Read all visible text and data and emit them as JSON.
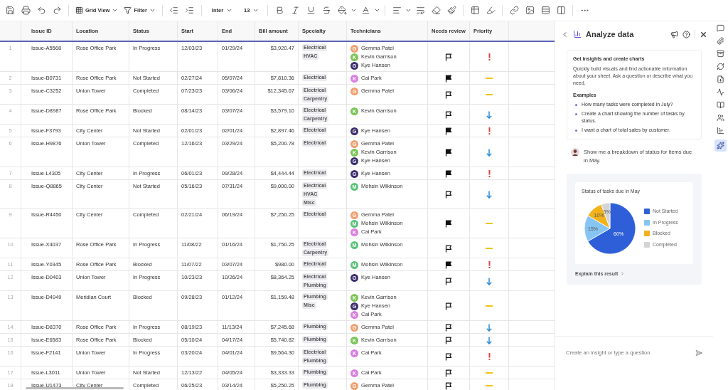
{
  "toolbar": {
    "view": "Grid View",
    "filter": "Filter",
    "font": "Inter",
    "size": "13"
  },
  "table": {
    "columns": [
      "Issue ID",
      "Location",
      "Status",
      "Start",
      "End",
      "Bill amount",
      "Specialty",
      "Technicians",
      "Needs review",
      "Priority"
    ],
    "rows": [
      {
        "num": "1",
        "id": "Issue-A5568",
        "location": "Rose Office Park",
        "status": "In Progress",
        "start": "12/03/23",
        "end": "01/29/24",
        "bill": "$3,920.47",
        "specialty": [
          "Electrical",
          "HVAC"
        ],
        "technicians": [
          {
            "initial": "G",
            "name": "Gemma Patel",
            "color": "#f0a070"
          },
          {
            "initial": "K",
            "name": "Kevin Garrison",
            "color": "#7cc456"
          },
          {
            "initial": "G",
            "name": "Kye Hansen",
            "color": "#3d2f6e"
          }
        ],
        "flagged": false,
        "priority": {
          "kind": "high"
        }
      },
      {
        "num": "2",
        "id": "Issue-B0731",
        "location": "Rose Office Park",
        "status": "Not Started",
        "start": "02/27/24",
        "end": "05/07/24",
        "bill": "$7,810.36",
        "specialty": [
          "Electrical"
        ],
        "technicians": [
          {
            "initial": "K",
            "name": "Cai Park",
            "color": "#d97ee0"
          }
        ],
        "flagged": true,
        "priority": {
          "kind": "medium"
        }
      },
      {
        "num": "3",
        "id": "Issue-C3252",
        "location": "Union Tower",
        "status": "Completed",
        "start": "07/23/23",
        "end": "03/06/24",
        "bill": "$12,345.67",
        "specialty": [
          "Electrical",
          "Carpentry"
        ],
        "technicians": [
          {
            "initial": "G",
            "name": "Gemma Patel",
            "color": "#f0a070"
          }
        ],
        "flagged": false,
        "priority": {
          "kind": "medium"
        }
      },
      {
        "num": "4",
        "id": "Issue-D8987",
        "location": "Rose Office Park",
        "status": "Blocked",
        "start": "08/14/23",
        "end": "03/07/24",
        "bill": "$3,579.10",
        "specialty": [
          "Electrical",
          "Carpentry"
        ],
        "technicians": [
          {
            "initial": "K",
            "name": "Kevin Garrison",
            "color": "#7cc456"
          }
        ],
        "flagged": false,
        "priority": {
          "kind": "low"
        }
      },
      {
        "num": "5",
        "id": "Issue-F3793",
        "location": "City Center",
        "status": "Not Started",
        "start": "02/01/23",
        "end": "02/01/24",
        "bill": "$2,897.46",
        "specialty": [
          "Electrical"
        ],
        "technicians": [
          {
            "initial": "G",
            "name": "Kye Hansen",
            "color": "#3d2f6e"
          }
        ],
        "flagged": true,
        "priority": {
          "kind": "high"
        }
      },
      {
        "num": "6",
        "id": "Issue-H9876",
        "location": "Union Tower",
        "status": "Completed",
        "start": "12/16/23",
        "end": "03/29/24",
        "bill": "$5,200.78",
        "specialty": [
          "Electrical"
        ],
        "technicians": [
          {
            "initial": "G",
            "name": "Gemma Patel",
            "color": "#f0a070"
          },
          {
            "initial": "K",
            "name": "Kevin Garrison",
            "color": "#7cc456"
          },
          {
            "initial": "G",
            "name": "Kye Hansen",
            "color": "#3d2f6e"
          }
        ],
        "flagged": true,
        "priority": {
          "kind": "low"
        }
      },
      {
        "num": "7",
        "id": "Issue-L4305",
        "location": "City Center",
        "status": "In Progress",
        "start": "06/01/23",
        "end": "09/28/24",
        "bill": "$4,444.44",
        "specialty": [
          "Electrical"
        ],
        "technicians": [
          {
            "initial": "G",
            "name": "Kye Hansen",
            "color": "#3d2f6e"
          }
        ],
        "flagged": true,
        "priority": {
          "kind": "high"
        }
      },
      {
        "num": "8",
        "id": "Issue-Q8865",
        "location": "City Center",
        "status": "Not Started",
        "start": "05/16/23",
        "end": "07/31/24",
        "bill": "$9,000.00",
        "specialty": [
          "Electrical",
          "HVAC",
          "Misc"
        ],
        "technicians": [
          {
            "initial": "M",
            "name": "Mohsin Wilkinson",
            "color": "#5cc27a"
          }
        ],
        "flagged": false,
        "priority": {
          "kind": "low"
        }
      },
      {
        "num": "9",
        "id": "Issue-R4450",
        "location": "City Center",
        "status": "Completed",
        "start": "02/21/24",
        "end": "06/19/24",
        "bill": "$7,250.25",
        "specialty": [
          "Electrical"
        ],
        "technicians": [
          {
            "initial": "G",
            "name": "Gemma Patel",
            "color": "#f0a070"
          },
          {
            "initial": "M",
            "name": "Mohsin Wilkinson",
            "color": "#5cc27a"
          },
          {
            "initial": "K",
            "name": "Cai Park",
            "color": "#d97ee0"
          }
        ],
        "flagged": true,
        "priority": {
          "kind": "medium"
        }
      },
      {
        "num": "10",
        "id": "Issue-X4037",
        "location": "Rose Office Park",
        "status": "In Progress",
        "start": "11/08/22",
        "end": "01/16/24",
        "bill": "$1,750.25",
        "specialty": [
          "Electrical",
          "Carpentry"
        ],
        "technicians": [
          {
            "initial": "M",
            "name": "Mohsin Wilkinson",
            "color": "#5cc27a"
          }
        ],
        "flagged": false,
        "priority": {
          "kind": "medium"
        }
      },
      {
        "num": "11",
        "id": "Issue-Y0345",
        "location": "Rose Office Park",
        "status": "Blocked",
        "start": "11/07/22",
        "end": "03/07/24",
        "bill": "$980.00",
        "specialty": [
          "Electrical"
        ],
        "technicians": [
          {
            "initial": "M",
            "name": "Mohsin Wilkinson",
            "color": "#5cc27a"
          }
        ],
        "flagged": true,
        "priority": {
          "kind": "high"
        }
      },
      {
        "num": "12",
        "id": "Issue-D0403",
        "location": "Union Tower",
        "status": "In Progress",
        "start": "10/23/23",
        "end": "10/26/24",
        "bill": "$8,364.25",
        "specialty": [
          "Electrical",
          "Plumbing"
        ],
        "technicians": [
          {
            "initial": "G",
            "name": "Kye Hansen",
            "color": "#3d2f6e"
          }
        ],
        "flagged": false,
        "priority": {
          "kind": "low"
        }
      },
      {
        "num": "13",
        "id": "Issue-D4949",
        "location": "Meridian Court",
        "status": "Blocked",
        "start": "09/28/23",
        "end": "01/12/24",
        "bill": "$1,159.48",
        "specialty": [
          "Plumbing",
          "Misc"
        ],
        "technicians": [
          {
            "initial": "K",
            "name": "Kevin Garrison",
            "color": "#7cc456"
          },
          {
            "initial": "G",
            "name": "Kye Hansen",
            "color": "#3d2f6e"
          },
          {
            "initial": "K",
            "name": "Cai Park",
            "color": "#d97ee0"
          }
        ],
        "flagged": false,
        "priority": {
          "kind": "medium"
        }
      },
      {
        "num": "14",
        "id": "Issue-D8370",
        "location": "Rose Office Park",
        "status": "In Progress",
        "start": "08/19/23",
        "end": "11/13/24",
        "bill": "$7,245.68",
        "specialty": [
          "Plumbing"
        ],
        "technicians": [
          {
            "initial": "G",
            "name": "Gemma Patel",
            "color": "#f0a070"
          }
        ],
        "flagged": false,
        "priority": {
          "kind": "low"
        }
      },
      {
        "num": "15",
        "id": "Issue-E6583",
        "location": "Rose Office Park",
        "status": "Blocked",
        "start": "05/10/24",
        "end": "04/17/24",
        "bill": "$5,740.82",
        "specialty": [
          "Plumbing"
        ],
        "technicians": [
          {
            "initial": "K",
            "name": "Kevin Garrison",
            "color": "#7cc456"
          }
        ],
        "flagged": false,
        "priority": {
          "kind": "low"
        }
      },
      {
        "num": "16",
        "id": "Issue-F2141",
        "location": "Union Tower",
        "status": "In Progress",
        "start": "03/20/24",
        "end": "04/01/24",
        "bill": "$9,564.30",
        "specialty": [
          "Electrical",
          "Plumbing"
        ],
        "technicians": [
          {
            "initial": "K",
            "name": "Cai Park",
            "color": "#d97ee0"
          }
        ],
        "flagged": false,
        "priority": {
          "kind": "high"
        }
      },
      {
        "num": "17",
        "id": "Issue-L3011",
        "location": "Union Tower",
        "status": "Not Started",
        "start": "12/13/22",
        "end": "04/05/24",
        "bill": "$3,333.33",
        "specialty": [
          "Plumbing"
        ],
        "technicians": [
          {
            "initial": "K",
            "name": "Cai Park",
            "color": "#d97ee0"
          }
        ],
        "flagged": false,
        "priority": {
          "kind": "medium"
        }
      },
      {
        "num": "18",
        "id": "Issue-U1473",
        "location": "City Center",
        "status": "Completed",
        "start": "06/25/23",
        "end": "03/14/24",
        "bill": "$5,250.25",
        "specialty": [
          "Plumbing"
        ],
        "technicians": [
          {
            "initial": "G",
            "name": "Gemma Patel",
            "color": "#f0a070"
          }
        ],
        "flagged": false,
        "priority": {
          "kind": "medium"
        }
      }
    ]
  },
  "panel": {
    "title": "Analyze data",
    "intro": {
      "heading": "Get insights and create charts",
      "text": "Quickly build visuals and find actionable information about your sheet. Ask a question or describe what you need.",
      "examples_label": "Examples",
      "examples": [
        "How many tasks were completed in July?",
        "Create a chart showing the number of tasks by status.",
        "I want a chart of total sales by customer."
      ]
    },
    "message": "Show me a breakdown of status for items due in May.",
    "chart_data": {
      "type": "pie",
      "title": "Status of tasks due in May",
      "categories": [
        "Not Started",
        "In Progress",
        "Blocked",
        "Completed"
      ],
      "values": [
        60,
        15,
        10,
        5
      ],
      "colors": [
        "#2f5fd8",
        "#86c5f2",
        "#f2b21c",
        "#d4d4d4"
      ],
      "value_labels": [
        "60%",
        "15%",
        "10%",
        "5%"
      ],
      "legend": "right"
    },
    "explain": "Explain this result",
    "input": {
      "placeholder": "Create an insight or type a question"
    }
  }
}
